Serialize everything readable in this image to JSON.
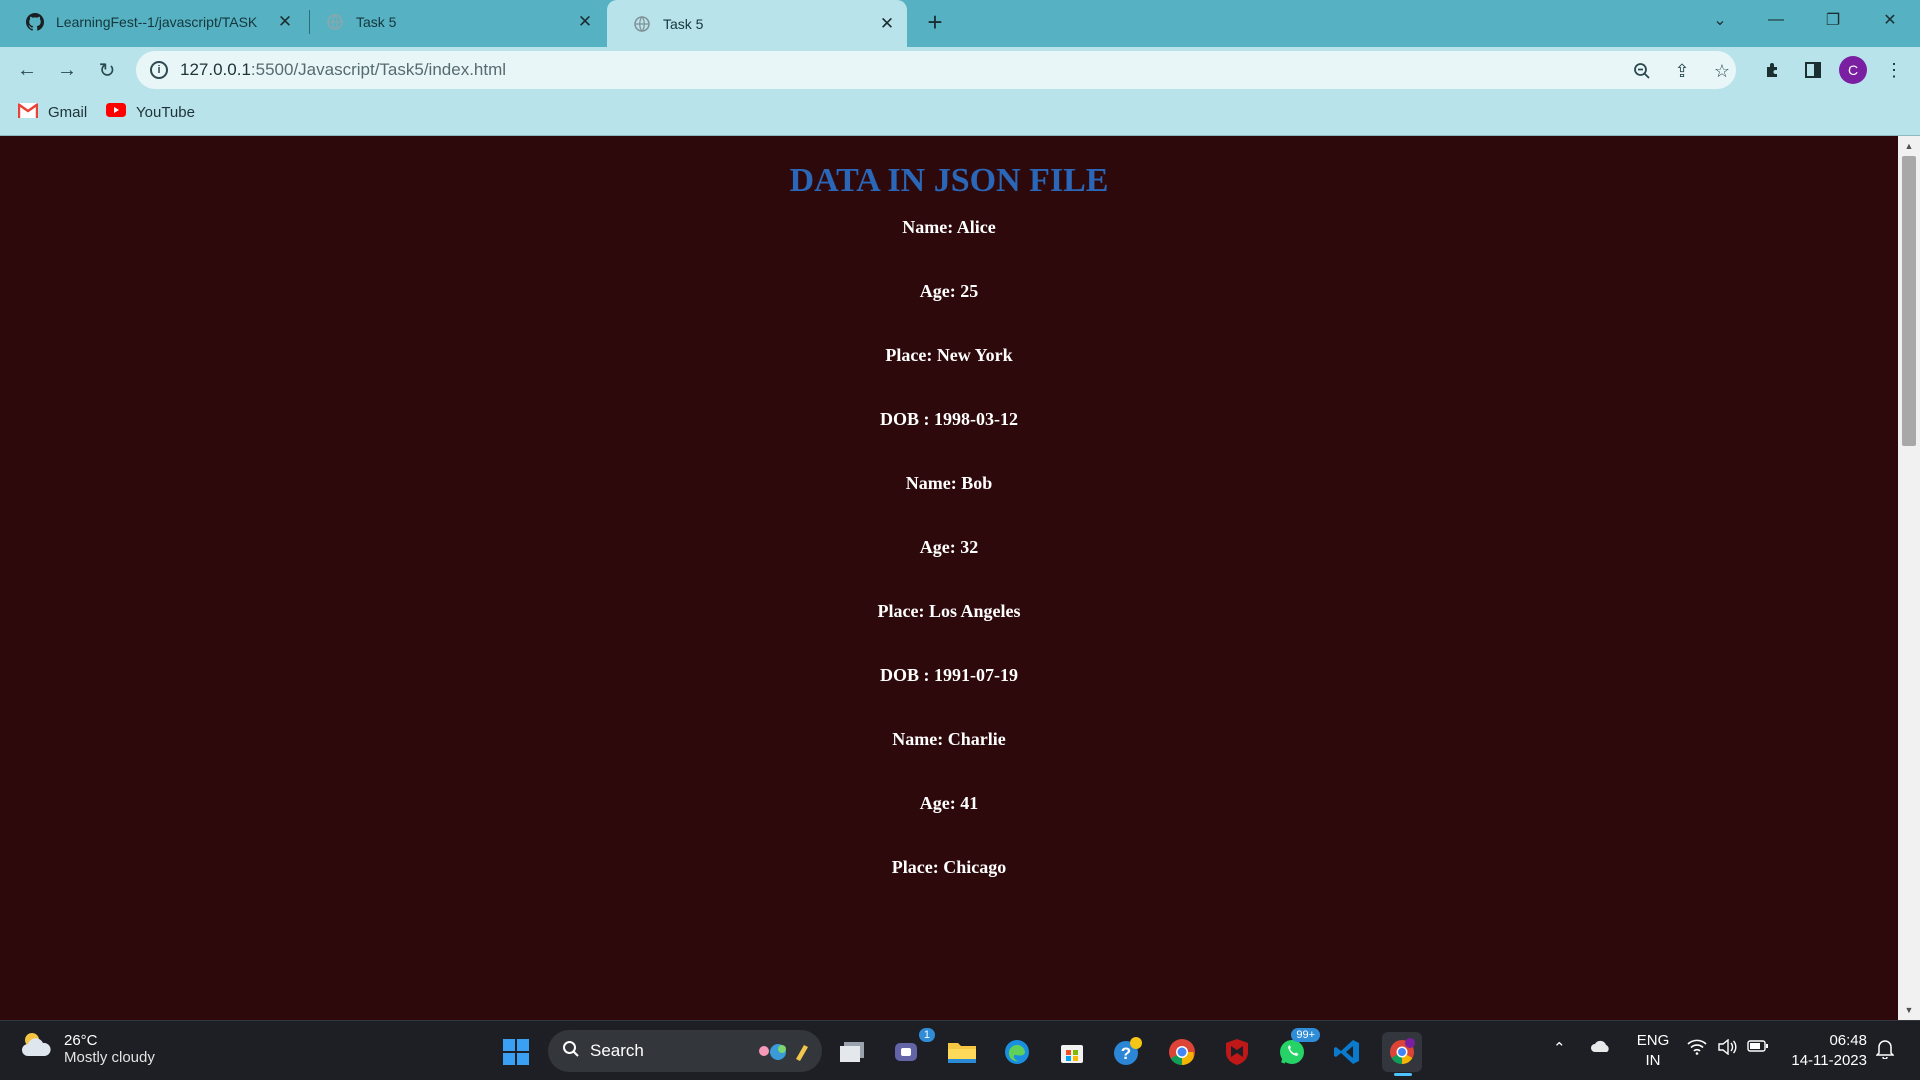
{
  "browser": {
    "tabs": [
      {
        "title": "LearningFest--1/javascript/TASK",
        "icon": "github-icon"
      },
      {
        "title": "Task 5",
        "icon": "globe-icon"
      },
      {
        "title": "Task 5",
        "icon": "globe-icon",
        "active": true
      }
    ],
    "url_host": "127.0.0.1",
    "url_path": ":5500/Javascript/Task5/index.html",
    "bookmarks": [
      {
        "label": "Gmail",
        "icon": "gmail-icon"
      },
      {
        "label": "YouTube",
        "icon": "youtube-icon"
      }
    ],
    "profile_initial": "C"
  },
  "page": {
    "heading": "DATA IN JSON FILE",
    "records": [
      {
        "name": "Name: Alice",
        "age": "Age: 25",
        "place": "Place: New York",
        "dob": "DOB : 1998-03-12"
      },
      {
        "name": "Name: Bob",
        "age": "Age: 32",
        "place": "Place: Los Angeles",
        "dob": "DOB : 1991-07-19"
      },
      {
        "name": "Name: Charlie",
        "age": "Age: 41",
        "place": "Place: Chicago",
        "dob": ""
      }
    ]
  },
  "taskbar": {
    "weather_temp": "26°C",
    "weather_desc": "Mostly cloudy",
    "search_label": "Search",
    "teams_badge": "1",
    "whatsapp_badge": "99+",
    "lang_top": "ENG",
    "lang_bottom": "IN",
    "time": "06:48",
    "date": "14-11-2023"
  },
  "colors": {
    "page_bg": "#2e090b",
    "heading": "#2b67b8",
    "tabstrip": "#56b2c2",
    "toolbar": "#b9e3ea",
    "taskbar": "#1d1f24"
  }
}
